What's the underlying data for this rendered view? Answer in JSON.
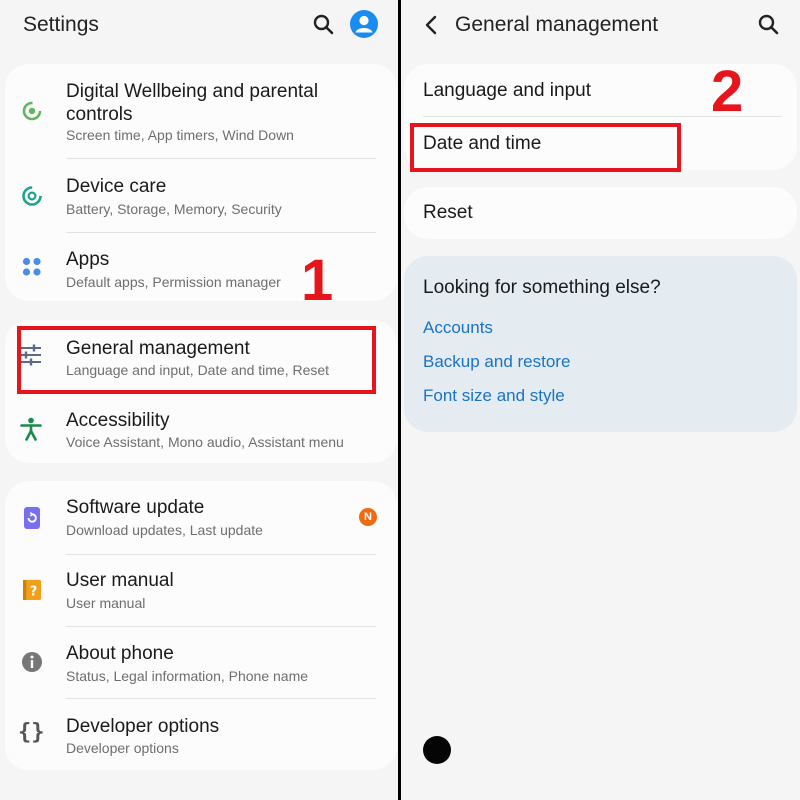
{
  "left": {
    "title": "Settings",
    "icons": {
      "search": "search-icon",
      "profile": "profile-icon"
    },
    "groups": [
      [
        {
          "title_lines": [
            "Digital Wellbeing and parental",
            "controls"
          ],
          "subtitle": "Screen time, App timers, Wind Down",
          "icon": "digital-wellbeing-icon"
        },
        {
          "title": "Device care",
          "subtitle": "Battery, Storage, Memory, Security",
          "icon": "device-care-icon"
        },
        {
          "title": "Apps",
          "subtitle": "Default apps, Permission manager",
          "icon": "apps-icon"
        }
      ],
      [
        {
          "title": "General management",
          "subtitle": "Language and input, Date and time, Reset",
          "icon": "general-management-icon"
        },
        {
          "title": "Accessibility",
          "subtitle": "Voice Assistant, Mono audio, Assistant menu",
          "icon": "accessibility-icon"
        }
      ],
      [
        {
          "title": "Software update",
          "subtitle": "Download updates, Last update",
          "icon": "software-update-icon",
          "badge": "N"
        },
        {
          "title": "User manual",
          "subtitle": "User manual",
          "icon": "user-manual-icon"
        },
        {
          "title": "About phone",
          "subtitle": "Status, Legal information, Phone name",
          "icon": "about-phone-icon"
        },
        {
          "title": "Developer options",
          "subtitle": "Developer options",
          "icon": "developer-options-icon"
        }
      ]
    ],
    "annotation_number": "1"
  },
  "right": {
    "title": "General management",
    "icons": {
      "back": "back-arrow-icon",
      "search": "search-icon"
    },
    "items": [
      "Language and input",
      "Date and time",
      "Reset"
    ],
    "suggestions": {
      "heading": "Looking for something else?",
      "links": [
        "Accounts",
        "Backup and restore",
        "Font size and style"
      ]
    },
    "annotation_number": "2"
  },
  "colors": {
    "highlight": "#e8141c",
    "link": "#1a73c4",
    "badge": "#f06a12"
  }
}
